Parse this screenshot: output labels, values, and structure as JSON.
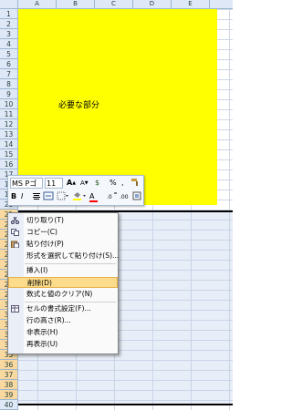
{
  "columns": [
    "A",
    "B",
    "C",
    "D",
    "E"
  ],
  "rows": [
    "1",
    "2",
    "3",
    "4",
    "5",
    "6",
    "7",
    "8",
    "9",
    "10",
    "11",
    "12",
    "13",
    "14",
    "15",
    "16",
    "17",
    "18",
    "19",
    "20",
    "21",
    "22",
    "23",
    "24",
    "25",
    "26",
    "27",
    "28",
    "29",
    "30",
    "31",
    "32",
    "33",
    "34",
    "35",
    "36",
    "37",
    "38",
    "39",
    "40"
  ],
  "cell_text": "必要な部分",
  "colors": {
    "highlight_fill": "#ffff00",
    "menu_hover": "#fcdc8a",
    "grid_line": "#d0d7e5"
  },
  "mini_toolbar": {
    "font_name": "MS Pゴ",
    "font_size": "11",
    "grow": "A",
    "shrink": "A",
    "currency": "$",
    "percent": "%",
    "comma": ",",
    "bold": "B",
    "italic": "I",
    "font_color": "A"
  },
  "context_menu": {
    "items": [
      {
        "label": "切り取り(T)",
        "icon": "scissors-icon"
      },
      {
        "label": "コピー(C)",
        "icon": "copy-icon"
      },
      {
        "label": "貼り付け(P)",
        "icon": "paste-icon"
      },
      {
        "label": "形式を選択して貼り付け(S)...",
        "icon": ""
      },
      {
        "label": "挿入(I)",
        "icon": ""
      },
      {
        "label": "削除(D)",
        "icon": ""
      },
      {
        "label": "数式と値のクリア(N)",
        "icon": ""
      },
      {
        "label": "セルの書式設定(F)...",
        "icon": "format-cells-icon"
      },
      {
        "label": "行の高さ(R)...",
        "icon": ""
      },
      {
        "label": "非表示(H)",
        "icon": ""
      },
      {
        "label": "再表示(U)",
        "icon": ""
      }
    ]
  }
}
